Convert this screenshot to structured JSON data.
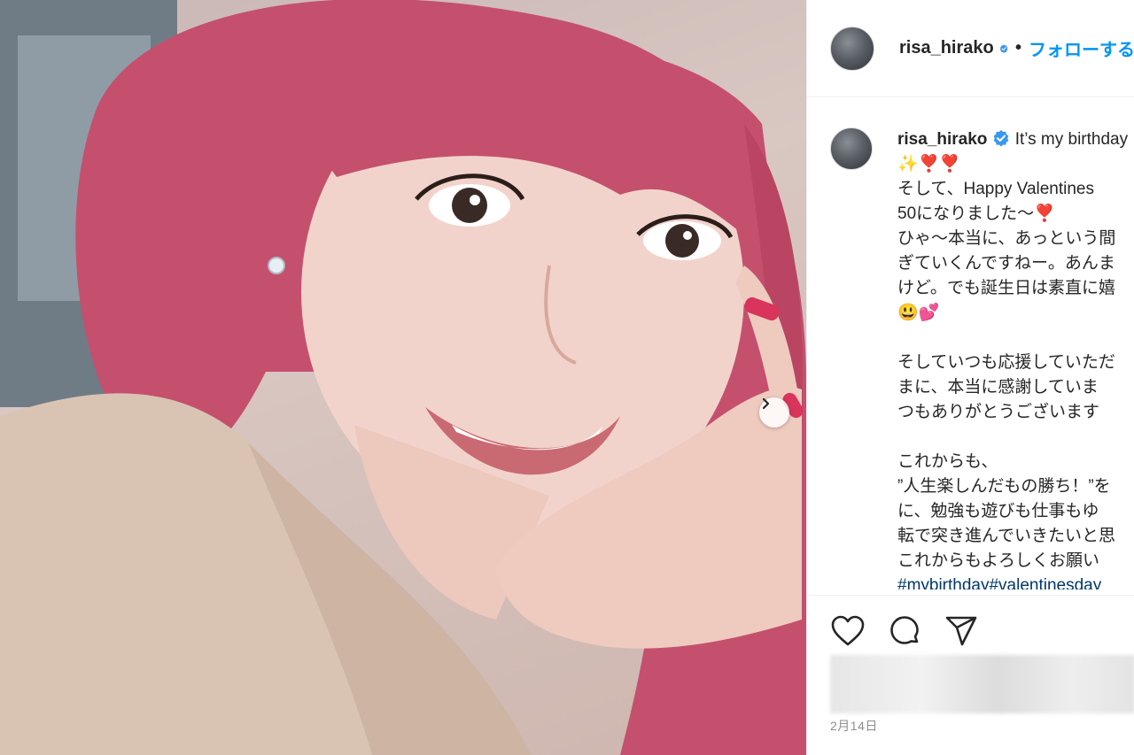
{
  "post": {
    "username": "risa_hirako",
    "follow_label": "フォローする",
    "dot": "•",
    "date": "2月14日"
  },
  "caption": {
    "first_line": "It’s my birthday",
    "lines": [
      "✨❣️❣️",
      "そして、Happy Valentines",
      "50になりました〜❣️",
      "ひゃ〜本当に、あっという間",
      "ぎていくんですねー。あんま",
      "けど。でも誕生日は素直に嬉",
      "😃💕",
      "",
      "そしていつも応援していただ",
      "まに、本当に感謝していま",
      "つもありがとうございます",
      "",
      "これからも、",
      "”人生楽しんだもの勝ち！”を",
      "に、勉強も遊びも仕事もゆ",
      "転で突き進んでいきたいと思",
      "これからもよろしくお願い"
    ],
    "hashtags": "#mybirthday#valentinesday"
  },
  "icons": {
    "verified": "verified-badge-icon",
    "like": "heart-icon",
    "comment": "comment-icon",
    "share": "paper-plane-icon",
    "next": "chevron-right-icon"
  },
  "colors": {
    "accent": "#0095f6",
    "verified": "#3897f0",
    "hashtag": "#00376b",
    "hair": "#c4506e"
  }
}
